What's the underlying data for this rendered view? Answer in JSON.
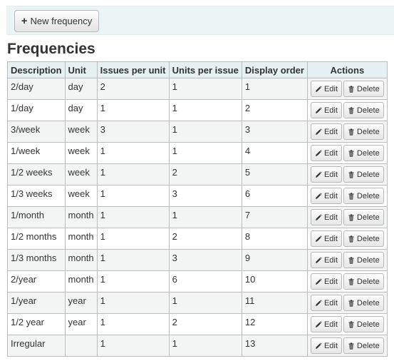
{
  "toolbar": {
    "new_label": "New frequency",
    "new_icon": "plus-icon"
  },
  "page": {
    "title": "Frequencies"
  },
  "table": {
    "headers": [
      "Description",
      "Unit",
      "Issues per unit",
      "Units per issue",
      "Display order",
      "Actions"
    ],
    "edit_label": "Edit",
    "delete_label": "Delete",
    "rows": [
      [
        "2/day",
        "day",
        "2",
        "1",
        "1"
      ],
      [
        "1/day",
        "day",
        "1",
        "1",
        "2"
      ],
      [
        "3/week",
        "week",
        "3",
        "1",
        "3"
      ],
      [
        "1/week",
        "week",
        "1",
        "1",
        "4"
      ],
      [
        "1/2 weeks",
        "week",
        "1",
        "2",
        "5"
      ],
      [
        "1/3 weeks",
        "week",
        "1",
        "3",
        "6"
      ],
      [
        "1/month",
        "month",
        "1",
        "1",
        "7"
      ],
      [
        "1/2 months",
        "month",
        "1",
        "2",
        "8"
      ],
      [
        "1/3 months",
        "month",
        "1",
        "3",
        "9"
      ],
      [
        "2/year",
        "month",
        "1",
        "6",
        "10"
      ],
      [
        "1/year",
        "year",
        "1",
        "1",
        "11"
      ],
      [
        "1/2 year",
        "year",
        "1",
        "2",
        "12"
      ],
      [
        "Irregular",
        "",
        "1",
        "1",
        "13"
      ]
    ]
  },
  "colors": {
    "toolbar_bg": "#edf4f6",
    "header_bg": "#e6f0f2",
    "stripe": "#f3f4f4"
  }
}
